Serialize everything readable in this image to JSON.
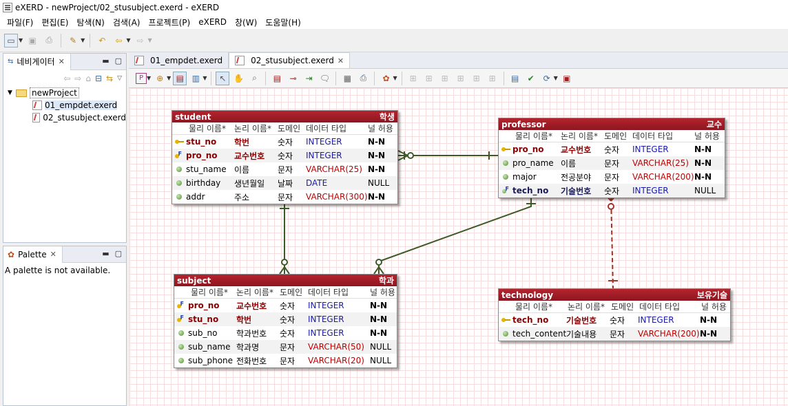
{
  "window": {
    "title": "eXERD - newProject/02_stusubject.exerd - eXERD"
  },
  "menu": [
    "파일(F)",
    "편집(E)",
    "탐색(N)",
    "검색(A)",
    "프로젝트(P)",
    "eXERD",
    "창(W)",
    "도움말(H)"
  ],
  "navigator": {
    "tab_label": "네비게이터",
    "project": "newProject",
    "files": [
      "01_empdet.exerd",
      "02_stusubject.exerd"
    ]
  },
  "palette": {
    "tab_label": "Palette",
    "message": "A palette is not available."
  },
  "editor_tabs": [
    "01_empdet.exerd",
    "02_stusubject.exerd"
  ],
  "column_headers": [
    "물리 이름*",
    "논리 이름*",
    "도메인",
    "데이터 타입",
    "널 허용"
  ],
  "entities": {
    "student": {
      "name": "student",
      "logical": "학생",
      "rows": [
        {
          "icon": "pk",
          "phys": "stu_no",
          "log": "학번",
          "dom": "숫자",
          "type": "INTEGER",
          "tcls": "int",
          "nul": "N-N"
        },
        {
          "icon": "pf",
          "phys": "pro_no",
          "log": "교수번호",
          "dom": "숫자",
          "type": "INTEGER",
          "tcls": "int",
          "nul": "N-N"
        },
        {
          "icon": "col",
          "phys": "stu_name",
          "log": "이름",
          "dom": "문자",
          "type": "VARCHAR(25)",
          "tcls": "vc",
          "nul": "N-N"
        },
        {
          "icon": "col",
          "phys": "birthday",
          "log": "생년월일",
          "dom": "날짜",
          "type": "DATE",
          "tcls": "int",
          "nul": "NULL"
        },
        {
          "icon": "col",
          "phys": "addr",
          "log": "주소",
          "dom": "문자",
          "type": "VARCHAR(300)",
          "tcls": "vc",
          "nul": "N-N"
        }
      ]
    },
    "professor": {
      "name": "professor",
      "logical": "교수",
      "rows": [
        {
          "icon": "pk",
          "phys": "pro_no",
          "log": "교수번호",
          "dom": "숫자",
          "type": "INTEGER",
          "tcls": "int",
          "nul": "N-N"
        },
        {
          "icon": "col",
          "phys": "pro_name",
          "log": "이름",
          "dom": "문자",
          "type": "VARCHAR(25)",
          "tcls": "vc",
          "nul": "N-N"
        },
        {
          "icon": "col",
          "phys": "major",
          "log": "전공분야",
          "dom": "문자",
          "type": "VARCHAR(200)",
          "tcls": "vc",
          "nul": "N-N"
        },
        {
          "icon": "fk",
          "phys": "tech_no",
          "log": "기술번호",
          "dom": "숫자",
          "type": "INTEGER",
          "tcls": "int",
          "nul": "NULL"
        }
      ]
    },
    "subject": {
      "name": "subject",
      "logical": "학과",
      "rows": [
        {
          "icon": "pf",
          "phys": "pro_no",
          "log": "교수번호",
          "dom": "숫자",
          "type": "INTEGER",
          "tcls": "int",
          "nul": "N-N"
        },
        {
          "icon": "pf",
          "phys": "stu_no",
          "log": "학번",
          "dom": "숫자",
          "type": "INTEGER",
          "tcls": "int",
          "nul": "N-N"
        },
        {
          "icon": "col",
          "phys": "sub_no",
          "log": "학과번호",
          "dom": "숫자",
          "type": "INTEGER",
          "tcls": "int",
          "nul": "N-N"
        },
        {
          "icon": "col",
          "phys": "sub_name",
          "log": "학과명",
          "dom": "문자",
          "type": "VARCHAR(50)",
          "tcls": "vc",
          "nul": "NULL"
        },
        {
          "icon": "col",
          "phys": "sub_phone",
          "log": "전화번호",
          "dom": "문자",
          "type": "VARCHAR(20)",
          "tcls": "vc",
          "nul": "NULL"
        }
      ]
    },
    "technology": {
      "name": "technology",
      "logical": "보유기술",
      "rows": [
        {
          "icon": "pk",
          "phys": "tech_no",
          "log": "기술번호",
          "dom": "숫자",
          "type": "INTEGER",
          "tcls": "int",
          "nul": "N-N"
        },
        {
          "icon": "col",
          "phys": "tech_content",
          "log": "기술내용",
          "dom": "문자",
          "type": "VARCHAR(200)",
          "tcls": "vc",
          "nul": "N-N"
        }
      ]
    }
  },
  "colors": {
    "entity_header": "#a01e28",
    "relation_line": "#3c5a28",
    "dashed_relation": "#a0322a",
    "grid": "#f6dede"
  }
}
